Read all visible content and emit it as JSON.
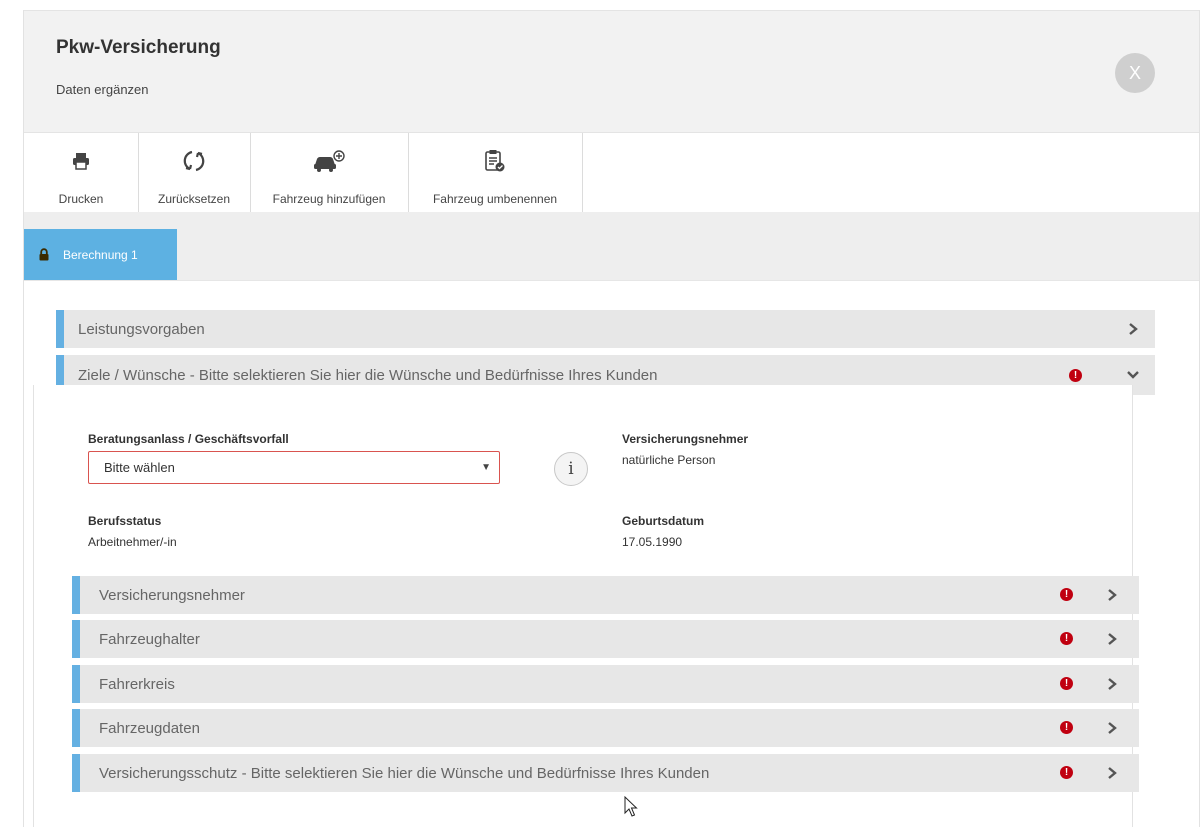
{
  "header": {
    "title": "Pkw-Versicherung",
    "subtitle": "Daten ergänzen",
    "close_label": "X"
  },
  "toolbar": {
    "print_label": "Drucken",
    "reset_label": "Zurücksetzen",
    "add_vehicle_label": "Fahrzeug hinzufügen",
    "rename_vehicle_label": "Fahrzeug umbenennen"
  },
  "tabs": [
    {
      "label": "Berechnung 1",
      "icon": "lock-icon",
      "active": true
    }
  ],
  "sections": {
    "leistungsvorgaben": "Leistungsvorgaben",
    "ziele": "Ziele / Wünsche - Bitte selektieren Sie hier die Wünsche und Bedürfnisse Ihres Kunden"
  },
  "form": {
    "beratungsanlass_label": "Beratungsanlass / Geschäftsvorfall",
    "beratungsanlass_value": "Bitte wählen",
    "info_label": "i",
    "versicherungsnehmer_label": "Versicherungsnehmer",
    "versicherungsnehmer_value": "natürliche Person",
    "berufsstatus_label": "Berufsstatus",
    "berufsstatus_value": "Arbeitnehmer/-in",
    "geburtsdatum_label": "Geburtsdatum",
    "geburtsdatum_value": "17.05.1990"
  },
  "subsections": [
    {
      "label": "Versicherungsnehmer",
      "warning": true
    },
    {
      "label": "Fahrzeughalter",
      "warning": true
    },
    {
      "label": "Fahrerkreis",
      "warning": true
    },
    {
      "label": "Fahrzeugdaten",
      "warning": true
    },
    {
      "label": "Versicherungsschutz - Bitte selektieren Sie hier die Wünsche und Bedürfnisse Ihres Kunden",
      "warning": true
    }
  ],
  "colors": {
    "accent": "#5db1e2",
    "warning": "#c00010",
    "accordion_bg": "#e7e7e7"
  }
}
